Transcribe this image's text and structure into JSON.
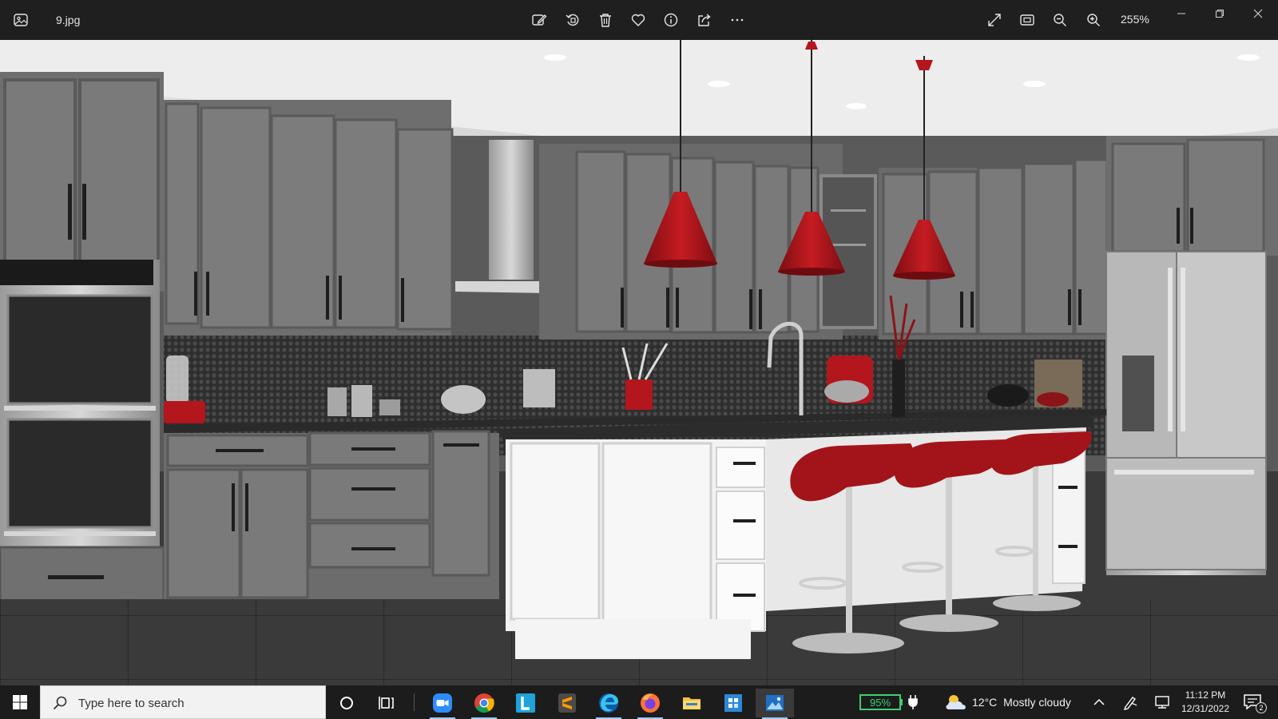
{
  "titlebar": {
    "filename": "9.jpg",
    "zoom_level": "255%",
    "toolbar_icons": [
      "edit-image-icon",
      "rotate-icon",
      "delete-icon",
      "favorite-heart-icon",
      "info-icon",
      "share-icon",
      "more-options-icon"
    ],
    "view_icons": [
      "fullscreen-icon",
      "fit-to-window-icon",
      "zoom-out-icon",
      "zoom-in-icon"
    ],
    "window_controls": [
      "minimize-icon",
      "maximize-icon",
      "close-icon"
    ]
  },
  "photo": {
    "description_alt": "kitchen photo",
    "accent_color": "#b3161c"
  },
  "taskbar": {
    "search_placeholder": "Type here to search",
    "pinned_apps": [
      "cortana-icon",
      "task-view-icon",
      "zoom-app-icon",
      "chrome-icon",
      "l-app-icon",
      "sublime-text-icon",
      "edge-icon",
      "firefox-icon",
      "file-explorer-icon",
      "store-app-icon",
      "photos-app-icon"
    ],
    "battery_percent": "95%",
    "weather_temp": "12°C",
    "weather_condition": "Mostly cloudy",
    "time": "11:12 PM",
    "date": "12/31/2022",
    "notification_count": "2"
  }
}
